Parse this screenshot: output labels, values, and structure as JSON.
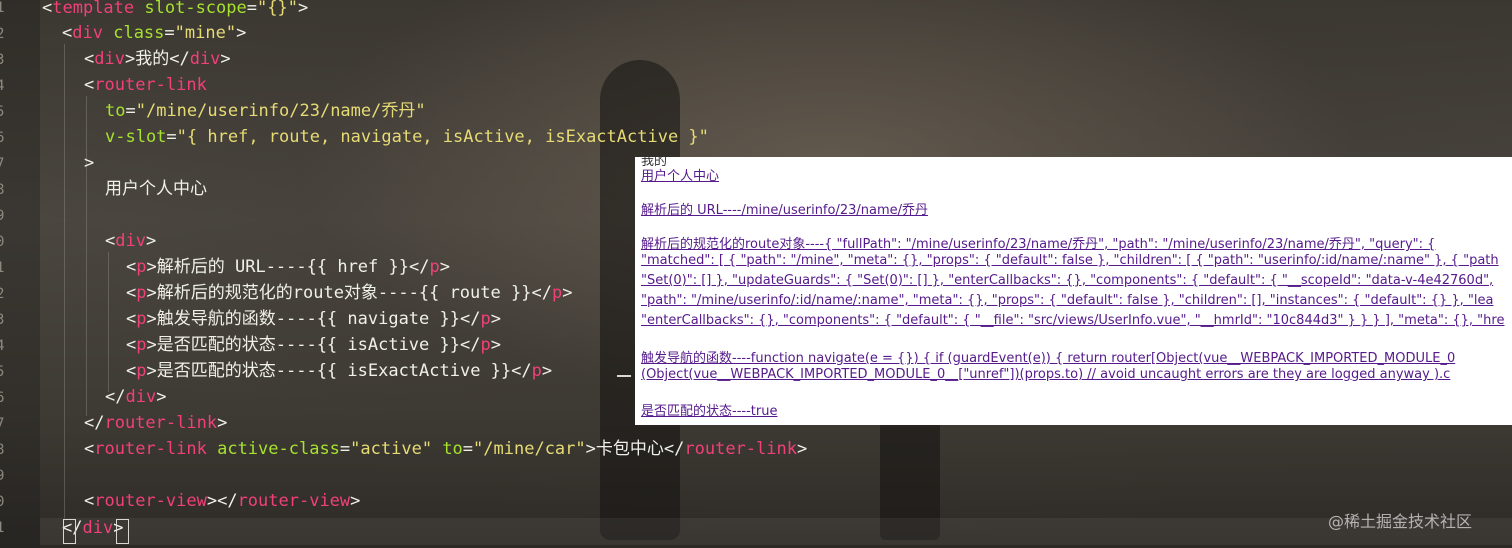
{
  "editor": {
    "line_numbers": [
      "1",
      "2",
      "3",
      "4",
      "5",
      "6",
      "7",
      "8",
      "9",
      "0",
      "1",
      "2",
      "3",
      "4",
      "5",
      "6",
      "7",
      "8",
      "9",
      "0",
      "1"
    ],
    "tokens": {
      "template": "template",
      "slot_scope_attr": "slot-scope",
      "slot_scope_val": "\"{}\"",
      "div": "div",
      "class_attr": "class",
      "class_val": "\"mine\"",
      "mine_text": "我的",
      "router_link": "router-link",
      "to_attr": "to",
      "to_val": "\"/mine/userinfo/23/name/乔丹\"",
      "vslot_attr": "v-slot",
      "vslot_val": "\"{ href, route, navigate, isActive, isExactActive }\"",
      "close_gt": ">",
      "user_center": "用户个人中心",
      "p": "p",
      "p1_text": "解析后的 URL----{{ href }}",
      "p2_text": "解析后的规范化的route对象----{{ route }}",
      "p3_text": "触发导航的函数----{{ navigate }}",
      "p4_text": "是否匹配的状态----{{ isActive }}",
      "p5_text": "是否匹配的状态----{{ isExactActive }}",
      "active_class_attr": "active-class",
      "active_class_val": "\"active\"",
      "car_to_val": "\"/mine/car\"",
      "card_center": "卡包中心",
      "router_view": "router-view"
    }
  },
  "preview": {
    "top_text": "我的",
    "lines": [
      "用户个人中心",
      "解析后的 URL----/mine/userinfo/23/name/乔丹",
      "解析后的规范化的route对象----{ \"fullPath\": \"/mine/userinfo/23/name/乔丹\", \"path\": \"/mine/userinfo/23/name/乔丹\", \"query\": {",
      "\"matched\": [ { \"path\": \"/mine\", \"meta\": {}, \"props\": { \"default\": false }, \"children\": [ { \"path\": \"userinfo/:id/name/:name\" }, { \"path",
      "\"Set(0)\": [] }, \"updateGuards\": { \"Set(0)\": [] }, \"enterCallbacks\": {}, \"components\": { \"default\": { \"__scopeId\": \"data-v-4e42760d\",",
      "\"path\": \"/mine/userinfo/:id/name/:name\", \"meta\": {}, \"props\": { \"default\": false }, \"children\": [], \"instances\": { \"default\": {} }, \"lea",
      "\"enterCallbacks\": {}, \"components\": { \"default\": { \"__file\": \"src/views/UserInfo.vue\", \"__hmrId\": \"10c844d3\" } } } ], \"meta\": {}, \"hre",
      "触发导航的函数----function navigate(e = {}) { if (guardEvent(e)) { return router[Object(vue__WEBPACK_IMPORTED_MODULE_0",
      "(Object(vue__WEBPACK_IMPORTED_MODULE_0__[\"unref\"])(props.to) // avoid uncaught errors are they are logged anyway ).c",
      "是否匹配的状态----true"
    ]
  },
  "watermark": "@稀土掘金技术社区",
  "colors": {
    "tag": "#f0407a",
    "attr": "#a6e22e",
    "string": "#e6db74",
    "link": "#551a8b"
  }
}
